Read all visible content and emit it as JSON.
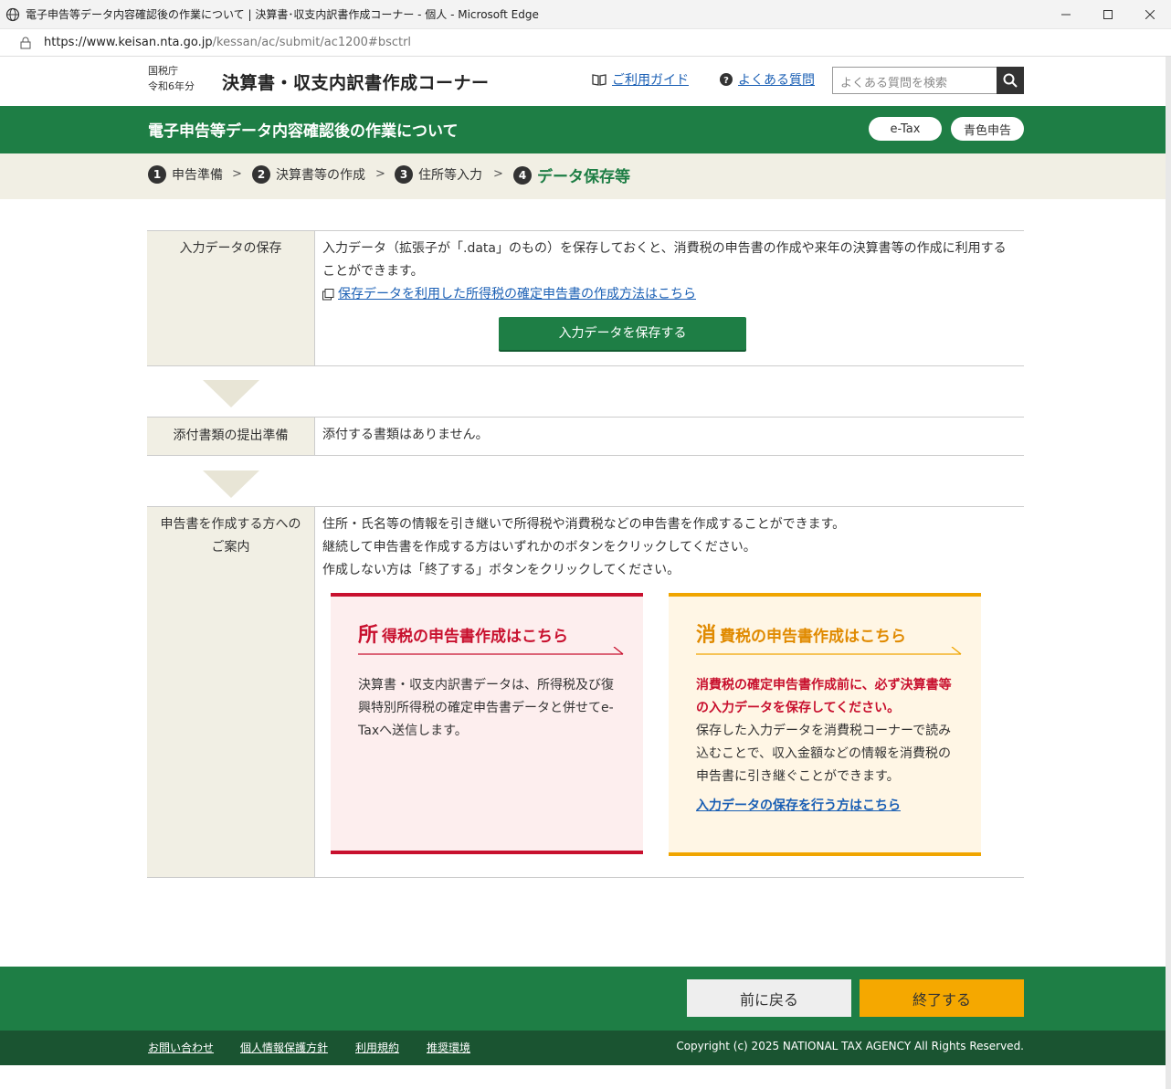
{
  "browser": {
    "window_title": "電子申告等データ内容確認後の作業について | 決算書･収支内訳書作成コーナー - 個人 - Microsoft Edge",
    "url_host": "https://www.keisan.nta.go.jp",
    "url_path": "/kessan/ac/submit/ac1200#bsctrl"
  },
  "header": {
    "agency_line1": "国税庁",
    "agency_line2": "令和6年分",
    "site_title": "決算書・収支内訳書作成コーナー",
    "guide_link": "ご利用ガイド",
    "faq_link": "よくある質問",
    "search_placeholder": "よくある質問を検索"
  },
  "band": {
    "page_title": "電子申告等データ内容確認後の作業について",
    "badge_etax": "e-Tax",
    "badge_blue": "青色申告"
  },
  "steps": [
    {
      "num": "1",
      "label": "申告準備"
    },
    {
      "num": "2",
      "label": "決算書等の作成"
    },
    {
      "num": "3",
      "label": "住所等入力"
    },
    {
      "num": "4",
      "label": "データ保存等"
    }
  ],
  "section_save": {
    "label": "入力データの保存",
    "text": "入力データ（拡張子が「.data」のもの）を保存しておくと、消費税の申告書の作成や来年の決算書等の作成に利用することができます。",
    "link": "保存データを利用した所得税の確定申告書の作成方法はこちら",
    "button": "入力データを保存する"
  },
  "section_attach": {
    "label": "添付書類の提出準備",
    "text": "添付する書類はありません。"
  },
  "section_guide": {
    "label": "申告書を作成する方への\nご案内",
    "line1": "住所・氏名等の情報を引き継いで所得税や消費税などの申告書を作成することができます。",
    "line2": "継続して申告書を作成する方はいずれかのボタンをクリックしてください。",
    "line3": "作成しない方は「終了する」ボタンをクリックしてください。",
    "card_income": {
      "big": "所",
      "rest": "得税の申告書作成はこちら",
      "text": "決算書・収支内訳書データは、所得税及び復興特別所得税の確定申告書データと併せてe-Taxへ送信します。"
    },
    "card_consumption": {
      "big": "消",
      "rest": "費税の申告書作成はこちら",
      "warning": "消費税の確定申告書作成前に、必ず決算書等の入力データを保存してください。",
      "text": "保存した入力データを消費税コーナーで読み込むことで、収入金額などの情報を消費税の申告書に引き継ぐことができます。",
      "link": "入力データの保存を行う方はこちら"
    }
  },
  "footer": {
    "back_button": "前に戻る",
    "finish_button": "終了する",
    "links": [
      "お問い合わせ",
      "個人情報保護方針",
      "利用規約",
      "推奨環境"
    ],
    "copyright": "Copyright (c) 2025 NATIONAL TAX AGENCY All Rights Reserved."
  },
  "colors": {
    "brand_green": "#1e7e45",
    "income_red": "#c8102e",
    "consumption_orange": "#f0a500",
    "finish_button": "#f5a800"
  }
}
